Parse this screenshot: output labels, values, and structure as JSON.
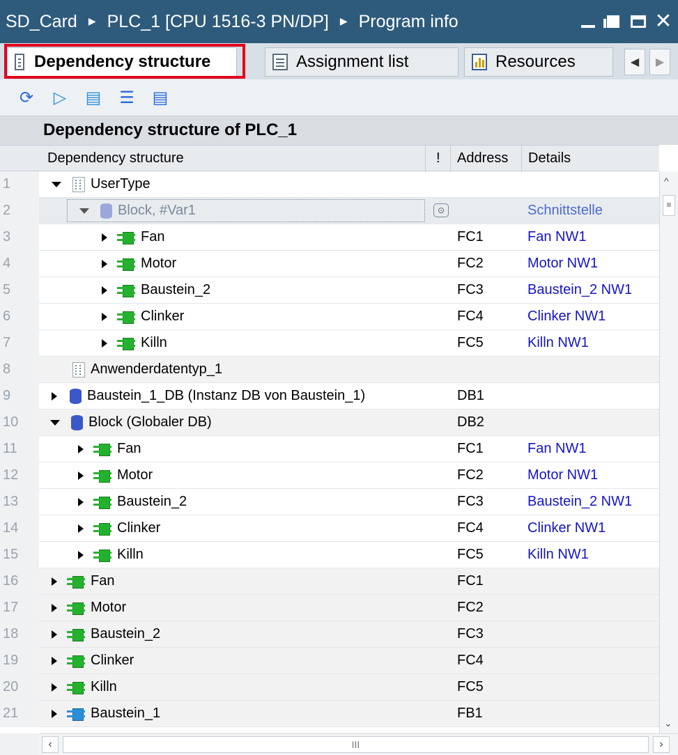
{
  "titlebar": {
    "crumbs": [
      "SD_Card",
      "PLC_1 [CPU 1516-3 PN/DP]",
      "Program info"
    ]
  },
  "tabs": [
    {
      "label": "Dependency structure",
      "active": true
    },
    {
      "label": "Assignment list",
      "active": false
    },
    {
      "label": "Resources",
      "active": false
    }
  ],
  "section_title": "Dependency structure of PLC_1",
  "columns": {
    "name": "Dependency structure",
    "flag": "!",
    "address": "Address",
    "details": "Details"
  },
  "rows": [
    {
      "num": "1",
      "name": "UserType",
      "address": "",
      "details": ""
    },
    {
      "num": "2",
      "name": "Block, #Var1",
      "address": "",
      "details": "Schnittstelle"
    },
    {
      "num": "3",
      "name": "Fan",
      "address": "FC1",
      "details": "Fan NW1"
    },
    {
      "num": "4",
      "name": "Motor",
      "address": "FC2",
      "details": "Motor NW1"
    },
    {
      "num": "5",
      "name": "Baustein_2",
      "address": "FC3",
      "details": "Baustein_2 NW1"
    },
    {
      "num": "6",
      "name": "Clinker",
      "address": "FC4",
      "details": "Clinker NW1"
    },
    {
      "num": "7",
      "name": "Killn",
      "address": "FC5",
      "details": "Killn NW1"
    },
    {
      "num": "8",
      "name": "Anwenderdatentyp_1",
      "address": "",
      "details": ""
    },
    {
      "num": "9",
      "name": "Baustein_1_DB (Instanz DB von Baustein_1)",
      "address": "DB1",
      "details": ""
    },
    {
      "num": "10",
      "name": "Block (Globaler DB)",
      "address": "DB2",
      "details": ""
    },
    {
      "num": "11",
      "name": "Fan",
      "address": "FC1",
      "details": "Fan NW1"
    },
    {
      "num": "12",
      "name": "Motor",
      "address": "FC2",
      "details": "Motor NW1"
    },
    {
      "num": "13",
      "name": "Baustein_2",
      "address": "FC3",
      "details": "Baustein_2 NW1"
    },
    {
      "num": "14",
      "name": "Clinker",
      "address": "FC4",
      "details": "Clinker NW1"
    },
    {
      "num": "15",
      "name": "Killn",
      "address": "FC5",
      "details": "Killn NW1"
    },
    {
      "num": "16",
      "name": "Fan",
      "address": "FC1",
      "details": ""
    },
    {
      "num": "17",
      "name": "Motor",
      "address": "FC2",
      "details": ""
    },
    {
      "num": "18",
      "name": "Baustein_2",
      "address": "FC3",
      "details": ""
    },
    {
      "num": "19",
      "name": "Clinker",
      "address": "FC4",
      "details": ""
    },
    {
      "num": "20",
      "name": "Killn",
      "address": "FC5",
      "details": ""
    },
    {
      "num": "21",
      "name": "Baustein_1",
      "address": "FB1",
      "details": ""
    }
  ],
  "hscroll_grip": "III",
  "colors": {
    "titlebar": "#2e5b7c",
    "highlight": "#e3001b",
    "link": "#1414c8",
    "fc_icon": "#24b22e",
    "fb_icon": "#2a8fd8",
    "db_icon": "#3b57c8"
  }
}
